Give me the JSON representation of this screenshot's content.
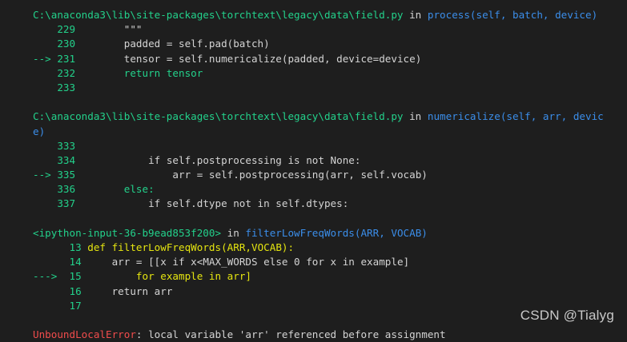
{
  "frames": [
    {
      "path": "C:\\anaconda3\\lib\\site-packages\\torchtext\\legacy\\data\\field.py",
      "in": " in ",
      "func": "process(self, batch, device)",
      "func_wrap": ""
    },
    {
      "path": "C:\\anaconda3\\lib\\site-packages\\torchtext\\legacy\\data\\field.py",
      "in": " in ",
      "func": "numericalize(self, arr, devic",
      "func_wrap": "e)"
    },
    {
      "path": "<ipython-input-36-b9ead853f200>",
      "in": " in ",
      "func": "filterLowFreqWords(ARR, VOCAB)",
      "func_wrap": ""
    }
  ],
  "lines": {
    "f1": [
      {
        "marker": "   ",
        "num": " 229",
        "code": "        \"\"\""
      },
      {
        "marker": "   ",
        "num": " 230",
        "code": "        padded = self.pad(batch)"
      },
      {
        "marker": "-->",
        "num": " 231",
        "code": "        tensor = self.numericalize(padded, device=device)"
      },
      {
        "marker": "   ",
        "num": " 232",
        "code": "        return tensor"
      },
      {
        "marker": "   ",
        "num": " 233",
        "code": ""
      }
    ],
    "f2": [
      {
        "marker": "   ",
        "num": " 333",
        "code": ""
      },
      {
        "marker": "   ",
        "num": " 334",
        "code": "            if self.postprocessing is not None:"
      },
      {
        "marker": "-->",
        "num": " 335",
        "code": "                arr = self.postprocessing(arr, self.vocab)"
      },
      {
        "marker": "   ",
        "num": " 336",
        "code": "        else:"
      },
      {
        "marker": "   ",
        "num": " 337",
        "code": "            if self.dtype not in self.dtypes:"
      }
    ],
    "f3": [
      {
        "marker": "    ",
        "num": "  13",
        "code": " def filterLowFreqWords(ARR,VOCAB):"
      },
      {
        "marker": "    ",
        "num": "  14",
        "code": "     arr = [[x if x<MAX_WORDS else 0 for x in example]"
      },
      {
        "marker": "--->",
        "num": "  15",
        "code": "         for example in arr]"
      },
      {
        "marker": "    ",
        "num": "  16",
        "code": "     return arr"
      },
      {
        "marker": "    ",
        "num": "  17",
        "code": ""
      }
    ]
  },
  "error": {
    "type": "UnboundLocalError",
    "message": ": local variable 'arr' referenced before assignment"
  },
  "watermark": "CSDN @Tialyg",
  "colors": {
    "background": "#1e1e1e",
    "path_green": "#23d18b",
    "function_blue": "#3b8eea",
    "error_red": "#f14c4c",
    "text": "#d4d4d4"
  }
}
